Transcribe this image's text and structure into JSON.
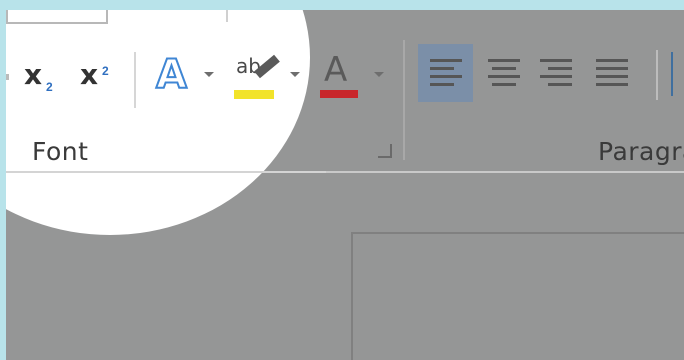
{
  "ribbon": {
    "font_group_label": "Font",
    "paragraph_group_label": "Paragra",
    "subscript_glyph": "x",
    "subscript_index": "2",
    "superscript_glyph": "x",
    "superscript_index": "2",
    "text_effects_glyph": "A",
    "highlight_glyph": "ab",
    "font_color_glyph": "A",
    "colors": {
      "highlight": "#f2e32a",
      "font_color": "#c8262b",
      "accent_blue": "#3f86d4",
      "active_align_bg": "#7b8fa8"
    }
  }
}
